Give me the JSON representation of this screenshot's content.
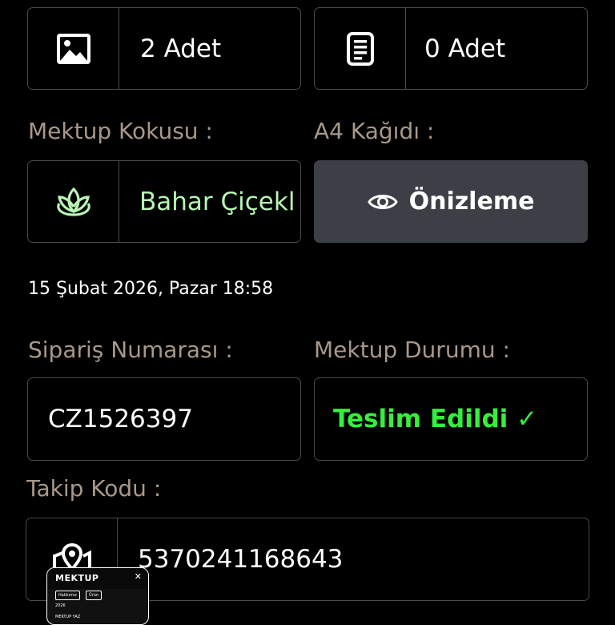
{
  "photos": {
    "value": "2 Adet",
    "icon": "image-icon"
  },
  "documents": {
    "value": "0 Adet",
    "icon": "document-icon"
  },
  "scent": {
    "label": "Mektup Kokusu :",
    "value": "Bahar Çiçekl",
    "icon": "lotus-icon",
    "color": "#b8f5b4"
  },
  "paper": {
    "label": "A4 Kağıdı :",
    "preview_label": "Önizleme",
    "icon": "eye-icon"
  },
  "date": "15 Şubat 2026, Pazar 18:58",
  "order": {
    "label": "Sipariş Numarası :",
    "value": "CZ1526397"
  },
  "status": {
    "label": "Mektup Durumu :",
    "value": "Teslim Edildi ✓",
    "color": "#32f03c"
  },
  "tracking": {
    "label": "Takip Kodu :",
    "value": "5370241168643",
    "icon": "map-pin-icon"
  },
  "mini_preview": {
    "logo": "MEKTUP",
    "close": "✕",
    "btn1": "Hakkımız",
    "btn2": "Ürün",
    "row1": "2026",
    "row2": "MEKTUP YAZ"
  }
}
